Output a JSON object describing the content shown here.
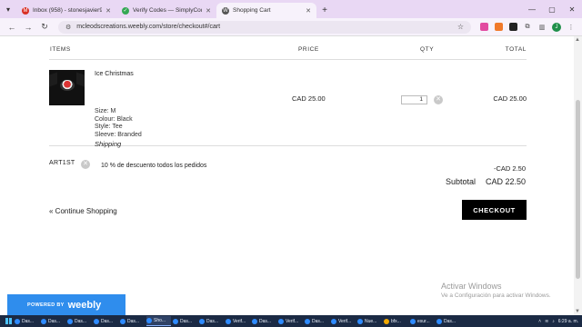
{
  "browser": {
    "tabs": [
      {
        "label": "Inbox (958) - stonesjavier942@",
        "favicon_color": "#d93025",
        "favicon_glyph": "M",
        "active": false
      },
      {
        "label": "Verify Codes — SimplyCodes",
        "favicon_color": "#34a853",
        "favicon_glyph": "✓",
        "active": false
      },
      {
        "label": "Shopping Cart",
        "favicon_color": "#555555",
        "favicon_glyph": "W",
        "active": true
      }
    ],
    "new_tab_glyph": "+",
    "url": "mcleodscreations.weebly.com/store/checkout#/cart",
    "profile_initial": "J"
  },
  "cart": {
    "headers": {
      "items": "ITEMS",
      "price": "PRICE",
      "qty": "QTY",
      "total": "TOTAL"
    },
    "item": {
      "name": "Ice Christmas",
      "options": [
        "Size: M",
        "Colour: Black",
        "Style: Tee",
        "Sleeve: Branded"
      ],
      "shipping": "Shipping",
      "price": "CAD 25.00",
      "qty": "1",
      "total": "CAD 25.00"
    },
    "coupon": {
      "code": "ART1ST",
      "description": "10 % de descuento todos los pedidos",
      "amount": "-CAD 2.50"
    },
    "subtotal_label": "Subtotal",
    "subtotal_value": "CAD 22.50",
    "continue_label": "« Continue Shopping",
    "checkout_label": "CHECKOUT"
  },
  "footer": {
    "powered_by": "POWERED BY",
    "brand": "weebly"
  },
  "watermark": {
    "line1": "Activar Windows",
    "line2": "Ve a Configuración para activar Windows."
  },
  "taskbar": {
    "items": [
      {
        "label": "Das...",
        "color": "#2e8bff"
      },
      {
        "label": "Das...",
        "color": "#2e8bff"
      },
      {
        "label": "Das...",
        "color": "#2e8bff"
      },
      {
        "label": "Das...",
        "color": "#2e8bff"
      },
      {
        "label": "Das...",
        "color": "#2e8bff"
      },
      {
        "label": "Sho...",
        "color": "#2e8bff",
        "active": true
      },
      {
        "label": "Das...",
        "color": "#2e8bff"
      },
      {
        "label": "Das...",
        "color": "#2e8bff"
      },
      {
        "label": "Verif...",
        "color": "#2e8bff"
      },
      {
        "label": "Das...",
        "color": "#2e8bff"
      },
      {
        "label": "Verif...",
        "color": "#2e8bff"
      },
      {
        "label": "Das...",
        "color": "#2e8bff"
      },
      {
        "label": "Verif...",
        "color": "#2e8bff"
      },
      {
        "label": "Nue...",
        "color": "#2e8bff"
      },
      {
        "label": "bfx...",
        "color": "#f2a900"
      },
      {
        "label": "esur...",
        "color": "#2e8bff"
      },
      {
        "label": "Das...",
        "color": "#2e8bff"
      }
    ],
    "time": "6:29 a. m."
  }
}
